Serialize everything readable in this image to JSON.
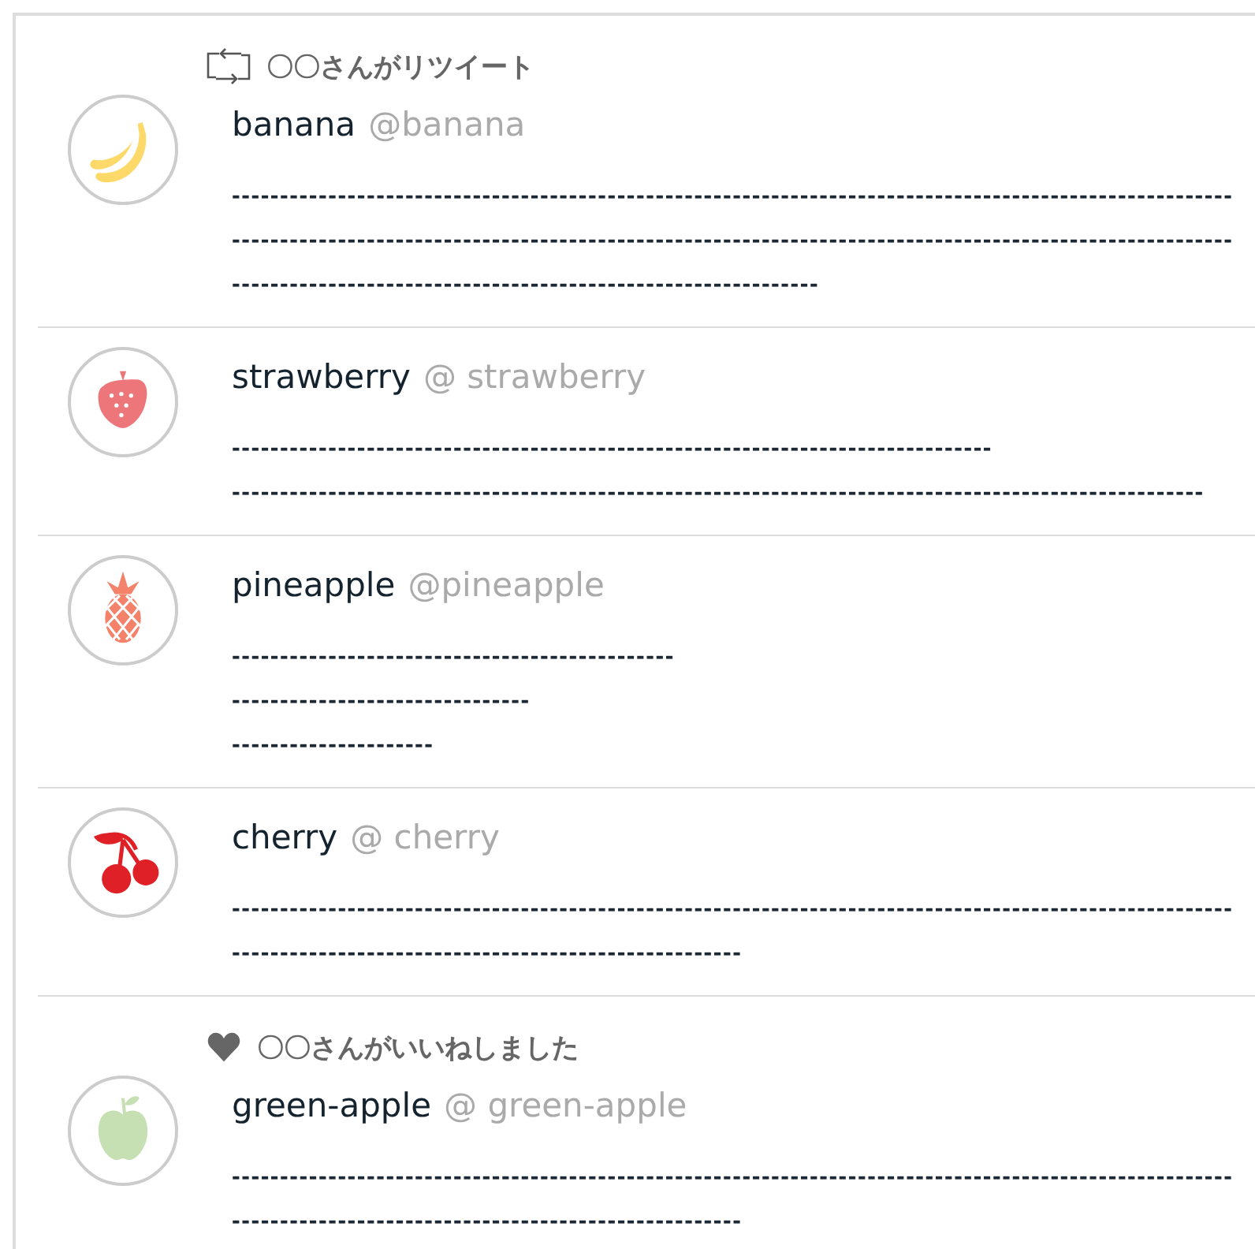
{
  "posts": [
    {
      "context": {
        "kind": "retweet",
        "text": "〇〇さんがリツイート"
      },
      "avatar": {
        "kind": "banana"
      },
      "name": "banana",
      "handle": "@banana",
      "lines": [
        "--------------------------------------------------------------------------------------------------------",
        "--------------------------------------------------------------------------------------------------------",
        "-------------------------------------------------------------"
      ]
    },
    {
      "avatar": {
        "kind": "strawberry"
      },
      "name": "strawberry",
      "handle": "@ strawberry",
      "lines": [
        "-------------------------------------------------------------------------------",
        "-----------------------------------------------------------------------------------------------------"
      ]
    },
    {
      "avatar": {
        "kind": "pineapple"
      },
      "name": "pineapple",
      "handle": "@pineapple",
      "lines": [
        "----------------------------------------------",
        "-------------------------------",
        "---------------------"
      ]
    },
    {
      "avatar": {
        "kind": "cherry"
      },
      "name": "cherry",
      "handle": "@ cherry",
      "lines": [
        "--------------------------------------------------------------------------------------------------------",
        "-----------------------------------------------------"
      ]
    },
    {
      "context": {
        "kind": "like",
        "text": "〇〇さんがいいねしました"
      },
      "avatar": {
        "kind": "green-apple"
      },
      "name": "green-apple",
      "handle": "@ green-apple",
      "lines": [
        "--------------------------------------------------------------------------------------------------------",
        "-----------------------------------------------------"
      ]
    }
  ]
}
